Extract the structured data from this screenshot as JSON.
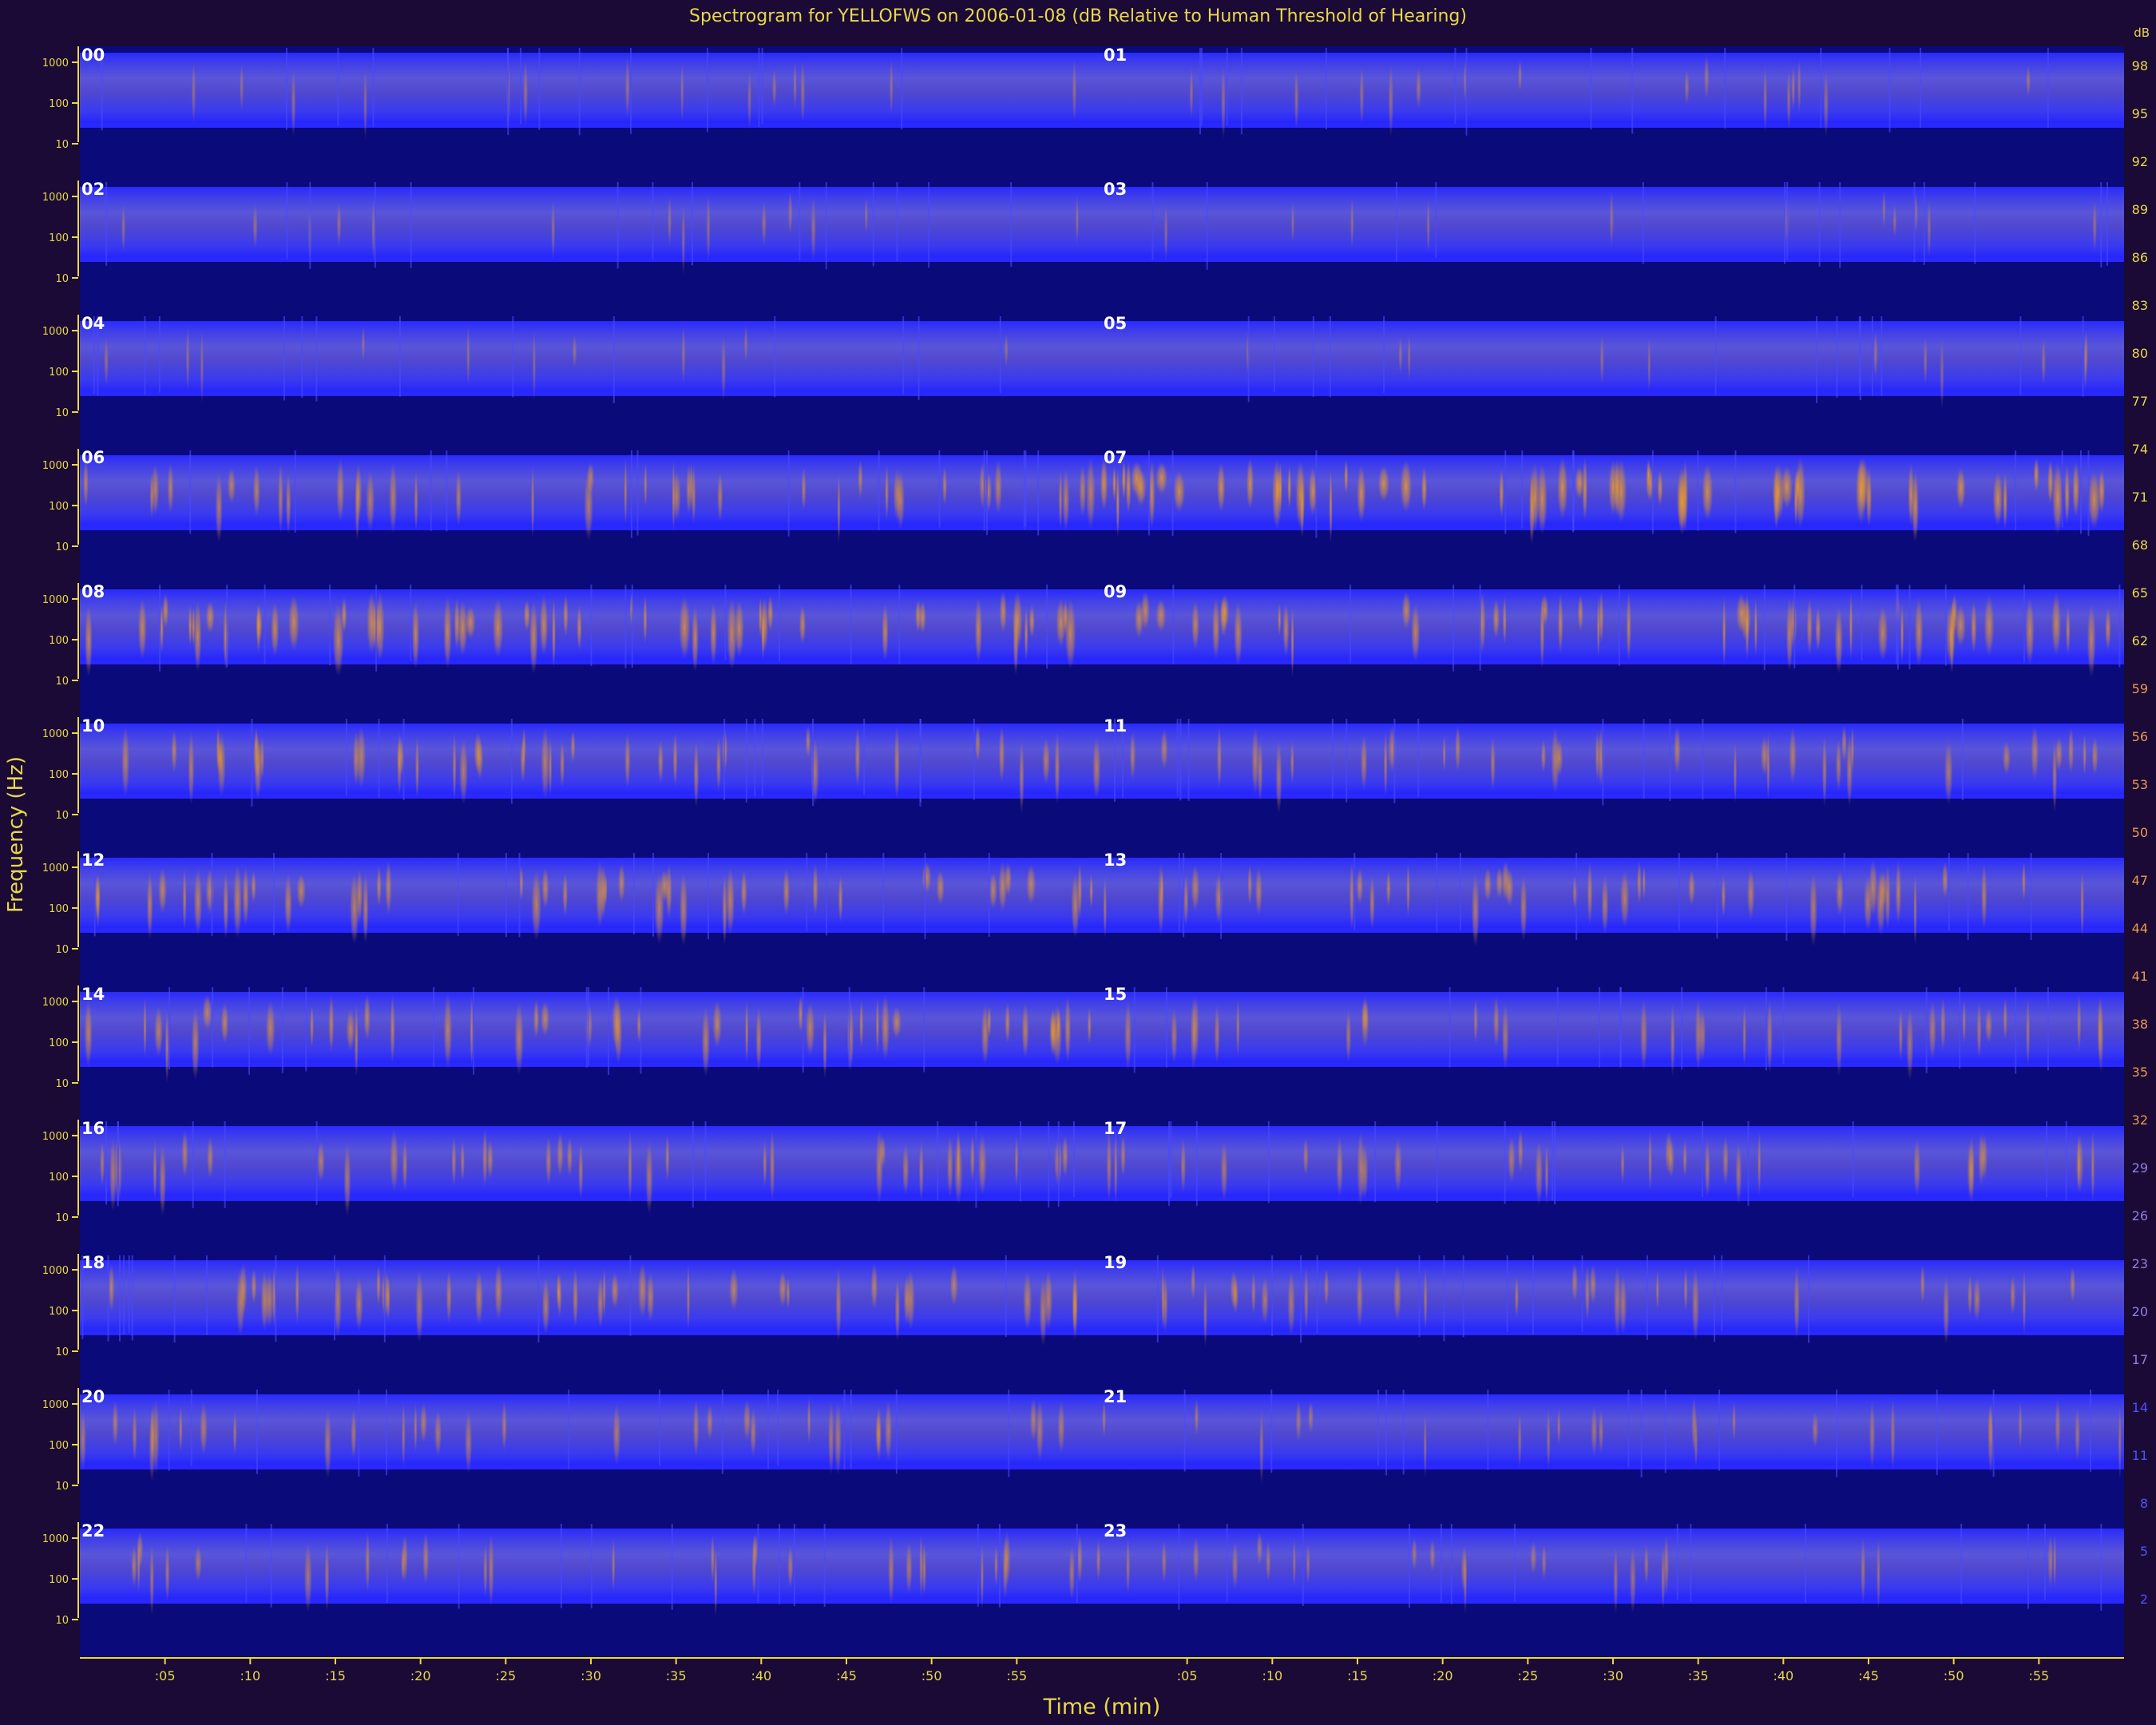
{
  "chart_data": {
    "type": "heatmap",
    "title": "Spectrogram for YELLOFWS on 2006-01-08 (dB Relative to Human Threshold of Hearing)",
    "xlabel": "Time (min)",
    "ylabel": "Frequency (Hz)",
    "panel_labels": [
      "00",
      "01",
      "02",
      "03",
      "04",
      "05",
      "06",
      "07",
      "08",
      "09",
      "10",
      "11",
      "12",
      "13",
      "14",
      "15",
      "16",
      "17",
      "18",
      "19",
      "20",
      "21",
      "22",
      "23"
    ],
    "panel_y_ticks": [
      "1000",
      "100",
      "10"
    ],
    "x_ticks": [
      ":05",
      ":10",
      ":15",
      ":20",
      ":25",
      ":30",
      ":35",
      ":40",
      ":45",
      ":50",
      ":55"
    ],
    "x_range": [
      0,
      60
    ],
    "colorbar_ticks": [
      98,
      95,
      92,
      89,
      86,
      83,
      80,
      77,
      74,
      71,
      68,
      65,
      62,
      59,
      56,
      53,
      50,
      47,
      44,
      41,
      38,
      35,
      32,
      29,
      26,
      23,
      20,
      17,
      14,
      11,
      8,
      5,
      2
    ],
    "colorbar_unit": "dB",
    "colors": {
      "background": "#1a0a35",
      "low": "#0a0a7a",
      "mid": "#3a3aff",
      "high": "#f0a030",
      "axis": "#e8d84a"
    },
    "hourly_activity": [
      0.15,
      0.18,
      0.15,
      0.12,
      0.12,
      0.12,
      0.45,
      0.7,
      0.6,
      0.55,
      0.45,
      0.4,
      0.5,
      0.45,
      0.5,
      0.35,
      0.4,
      0.35,
      0.45,
      0.35,
      0.35,
      0.25,
      0.35,
      0.25
    ]
  }
}
